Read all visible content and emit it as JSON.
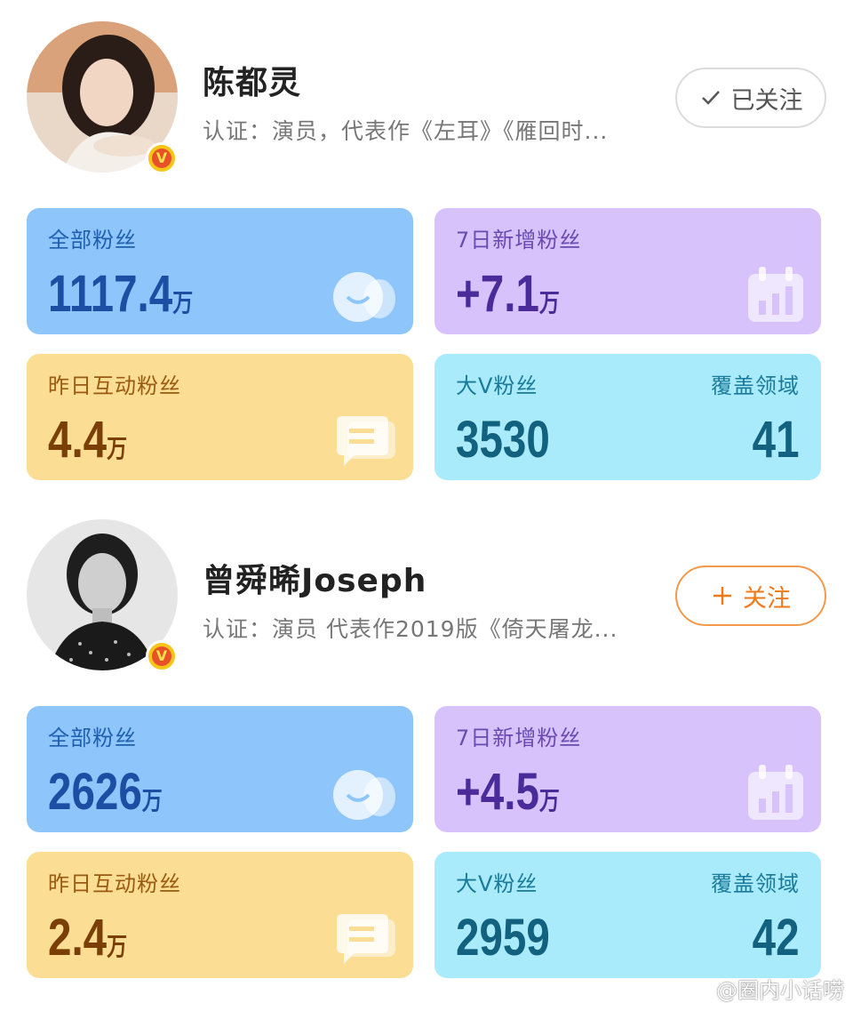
{
  "profiles": [
    {
      "name": "陈都灵",
      "certification": "认证：演员，代表作《左耳》《雁回时...",
      "verified_badge": "V",
      "follow": {
        "label": "已关注",
        "icon": "check-icon",
        "state": "followed"
      },
      "stats": {
        "total_fans": {
          "label": "全部粉丝",
          "value": "1117.4",
          "unit": "万"
        },
        "new_fans_7d": {
          "label": "7日新增粉丝",
          "value": "+7.1",
          "unit": "万"
        },
        "interactive_fans_yesterday": {
          "label": "昨日互动粉丝",
          "value": "4.4",
          "unit": "万"
        },
        "big_v_fans": {
          "label": "大V粉丝",
          "value": "3530",
          "coverage_label": "覆盖领域",
          "coverage_value": "41"
        }
      }
    },
    {
      "name": "曾舜晞Joseph",
      "certification": "认证：演员 代表作2019版《倚天屠龙...",
      "verified_badge": "V",
      "follow": {
        "label": "关注",
        "icon": "plus-icon",
        "state": "unfollowed"
      },
      "stats": {
        "total_fans": {
          "label": "全部粉丝",
          "value": "2626",
          "unit": "万"
        },
        "new_fans_7d": {
          "label": "7日新增粉丝",
          "value": "+4.5",
          "unit": "万"
        },
        "interactive_fans_yesterday": {
          "label": "昨日互动粉丝",
          "value": "2.4",
          "unit": "万"
        },
        "big_v_fans": {
          "label": "大V粉丝",
          "value": "2959",
          "coverage_label": "覆盖领域",
          "coverage_value": "42"
        }
      }
    }
  ],
  "watermark": "@圈内小话唠",
  "colors": {
    "total_fans_card": "#8ec6fb",
    "new_fans_card": "#d7c2fb",
    "interactive_card": "#fbdd94",
    "big_v_card": "#a9ebfb",
    "follow_accent": "#f07a1a"
  }
}
